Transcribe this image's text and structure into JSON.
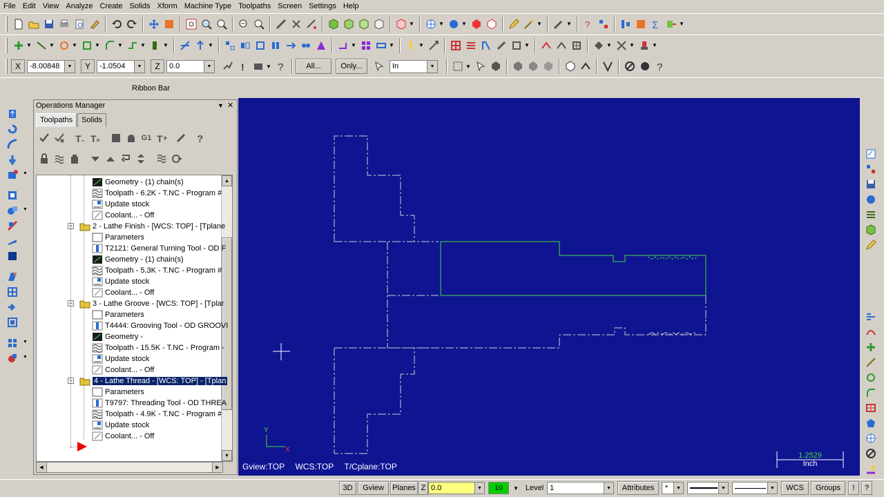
{
  "menu": [
    "File",
    "Edit",
    "View",
    "Analyze",
    "Create",
    "Solids",
    "Xform",
    "Machine Type",
    "Toolpaths",
    "Screen",
    "Settings",
    "Help"
  ],
  "autocursor": {
    "x_label": "X",
    "x_value": "-8.00848",
    "y_label": "Y",
    "y_value": "-1.0504",
    "z_label": "Z",
    "z_value": "0.0",
    "all_button": "All...",
    "only_button": "Only...",
    "units_value": "In"
  },
  "ribbon": {
    "label": "Ribbon Bar"
  },
  "ops_manager": {
    "title": "Operations Manager",
    "pin": "▼",
    "close": "✕",
    "tabs": [
      "Toolpaths",
      "Solids"
    ],
    "op_icons": [
      "G1"
    ],
    "tree": [
      {
        "text": "Geometry - (1) chain(s)",
        "icon": "geometry-icon"
      },
      {
        "text": "Toolpath - 6.2K - T.NC - Program #",
        "icon": "toolpath-icon"
      },
      {
        "text": "Update stock",
        "icon": "stock-icon"
      },
      {
        "text": "Coolant... - Off",
        "icon": "coolant-icon"
      },
      {
        "text": "2 - Lathe Finish - [WCS: TOP] - [Tplane",
        "icon": "folder-icon"
      },
      {
        "text": "Parameters",
        "icon": "parameters-icon"
      },
      {
        "text": "T2121: General Turning Tool - OD F",
        "icon": "tool-icon"
      },
      {
        "text": "Geometry - (1) chain(s)",
        "icon": "geometry-icon"
      },
      {
        "text": "Toolpath - 5.3K - T.NC - Program #",
        "icon": "toolpath-icon"
      },
      {
        "text": "Update stock",
        "icon": "stock-icon"
      },
      {
        "text": "Coolant... - Off",
        "icon": "coolant-icon"
      },
      {
        "text": "3 - Lathe Groove - [WCS: TOP] - [Tplar",
        "icon": "folder-icon"
      },
      {
        "text": "Parameters",
        "icon": "parameters-icon"
      },
      {
        "text": "T4444: Grooving Tool - OD GROOVI",
        "icon": "tool-icon"
      },
      {
        "text": "Geometry -",
        "icon": "geometry-icon"
      },
      {
        "text": "Toolpath - 15.5K - T.NC - Program -",
        "icon": "toolpath-icon"
      },
      {
        "text": "Update stock",
        "icon": "stock-icon"
      },
      {
        "text": "Coolant... - Off",
        "icon": "coolant-icon"
      },
      {
        "text": "4 - Lathe Thread - [WCS: TOP] - [Tplan",
        "icon": "folder-icon"
      },
      {
        "text": "Parameters",
        "icon": "parameters-icon"
      },
      {
        "text": "T9797: Threading Tool - OD THREA",
        "icon": "tool-icon"
      },
      {
        "text": "Toolpath - 4.9K - T.NC - Program #",
        "icon": "toolpath-icon"
      },
      {
        "text": "Update stock",
        "icon": "stock-icon"
      },
      {
        "text": "Coolant... - Off",
        "icon": "coolant-icon"
      }
    ]
  },
  "viewport": {
    "gview": "Gview:TOP",
    "wcs": "WCS:TOP",
    "tcplane": "T/Cplane:TOP",
    "axis_y": "Y",
    "axis_x": "X",
    "scale_value": "1.2529",
    "scale_unit": "Inch",
    "background": "#0f1491",
    "stock_color": "#d0d0d0",
    "part_color": "#3fdc3f"
  },
  "statusbar": {
    "btn_3d": "3D",
    "btn_gview": "Gview",
    "btn_planes": "Planes",
    "z_label": "Z",
    "z_value": "0.0",
    "color_value": "10",
    "level_label": "Level",
    "level_value": "1",
    "attributes": "Attributes",
    "point_style": "*",
    "wcs": "WCS",
    "groups": "Groups",
    "help": "!",
    "question": "?"
  }
}
